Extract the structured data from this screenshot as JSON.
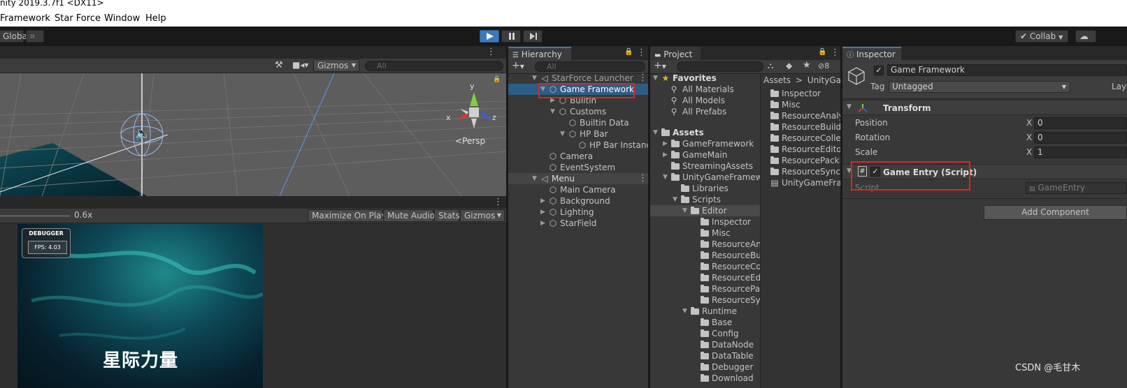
{
  "window": {
    "title": "nity 2019.3.7f1 <DX11>"
  },
  "menu": {
    "items": [
      "Framework",
      "Star Force",
      "Window",
      "Help"
    ]
  },
  "toolbar": {
    "global_label": "Global",
    "collab_label": "Collab"
  },
  "scene": {
    "gizmos_label": "Gizmos",
    "search_placeholder": "All",
    "persp_label": "Persp",
    "axis_x": "x",
    "axis_y": "y",
    "axis_z": "z"
  },
  "game": {
    "scale_label": "0.6x",
    "buttons": [
      "Maximize On Play",
      "Mute Audio",
      "Stats",
      "Gizmos"
    ],
    "debugger_title": "DEBUGGER",
    "fps_label": "FPS: 4.03",
    "title_text": "星际力量"
  },
  "hierarchy": {
    "tab_label": "Hierarchy",
    "search_placeholder": "All",
    "items": [
      {
        "label": "StarForce Launcher",
        "depth": 0
      },
      {
        "label": "Game Framework",
        "depth": 1
      },
      {
        "label": "Builtin",
        "depth": 2
      },
      {
        "label": "Customs",
        "depth": 2
      },
      {
        "label": "Builtin Data",
        "depth": 3
      },
      {
        "label": "HP Bar",
        "depth": 3
      },
      {
        "label": "HP Bar Instance",
        "depth": 4
      },
      {
        "label": "Camera",
        "depth": 1
      },
      {
        "label": "EventSystem",
        "depth": 1
      },
      {
        "label": "Menu",
        "depth": 0
      },
      {
        "label": "Main Camera",
        "depth": 1
      },
      {
        "label": "Background",
        "depth": 1
      },
      {
        "label": "Lighting",
        "depth": 1
      },
      {
        "label": "StarField",
        "depth": 1
      }
    ]
  },
  "project": {
    "tab_label": "Project",
    "hidden_count": "8",
    "breadcrumb": [
      "Assets",
      "UnityGame"
    ],
    "favorites_label": "Favorites",
    "favorites": [
      "All Materials",
      "All Models",
      "All Prefabs"
    ],
    "assets_label": "Assets",
    "tree": [
      "GameFramework",
      "GameMain",
      "StreamingAssets",
      "UnityGameFramewo",
      "Libraries",
      "Scripts",
      "Editor",
      "Inspector",
      "Misc",
      "ResourceAna",
      "ResourceBui",
      "ResourceCo",
      "ResourceEdi",
      "ResourcePac",
      "ResourceSyn",
      "Runtime",
      "Base",
      "Config",
      "DataNode",
      "DataTable",
      "Debugger",
      "Download"
    ],
    "grid": [
      "Inspector",
      "Misc",
      "ResourceAnaly",
      "ResourceBuilde",
      "ResourceCollec",
      "ResourceEditor",
      "ResourcePackE",
      "ResourceSyncT",
      "UnityGameFran"
    ]
  },
  "inspector": {
    "tab_label": "Inspector",
    "object_name": "Game Framework",
    "tag_label": "Tag",
    "tag_value": "Untagged",
    "layer_label": "Laye",
    "transform_label": "Transform",
    "position_label": "Position",
    "rotation_label": "Rotation",
    "scale_label": "Scale",
    "axis_x": "X",
    "position_x": "0",
    "rotation_x": "0",
    "scale_x": "1",
    "component_label": "Game Entry (Script)",
    "script_label": "Script",
    "script_value": "GameEntry",
    "add_component_label": "Add Component"
  },
  "watermark": "CSDN @毛甘木",
  "colors": {
    "accent": "#3a79bb",
    "highlight": "#e3231e",
    "selection": "#2c5d87"
  }
}
